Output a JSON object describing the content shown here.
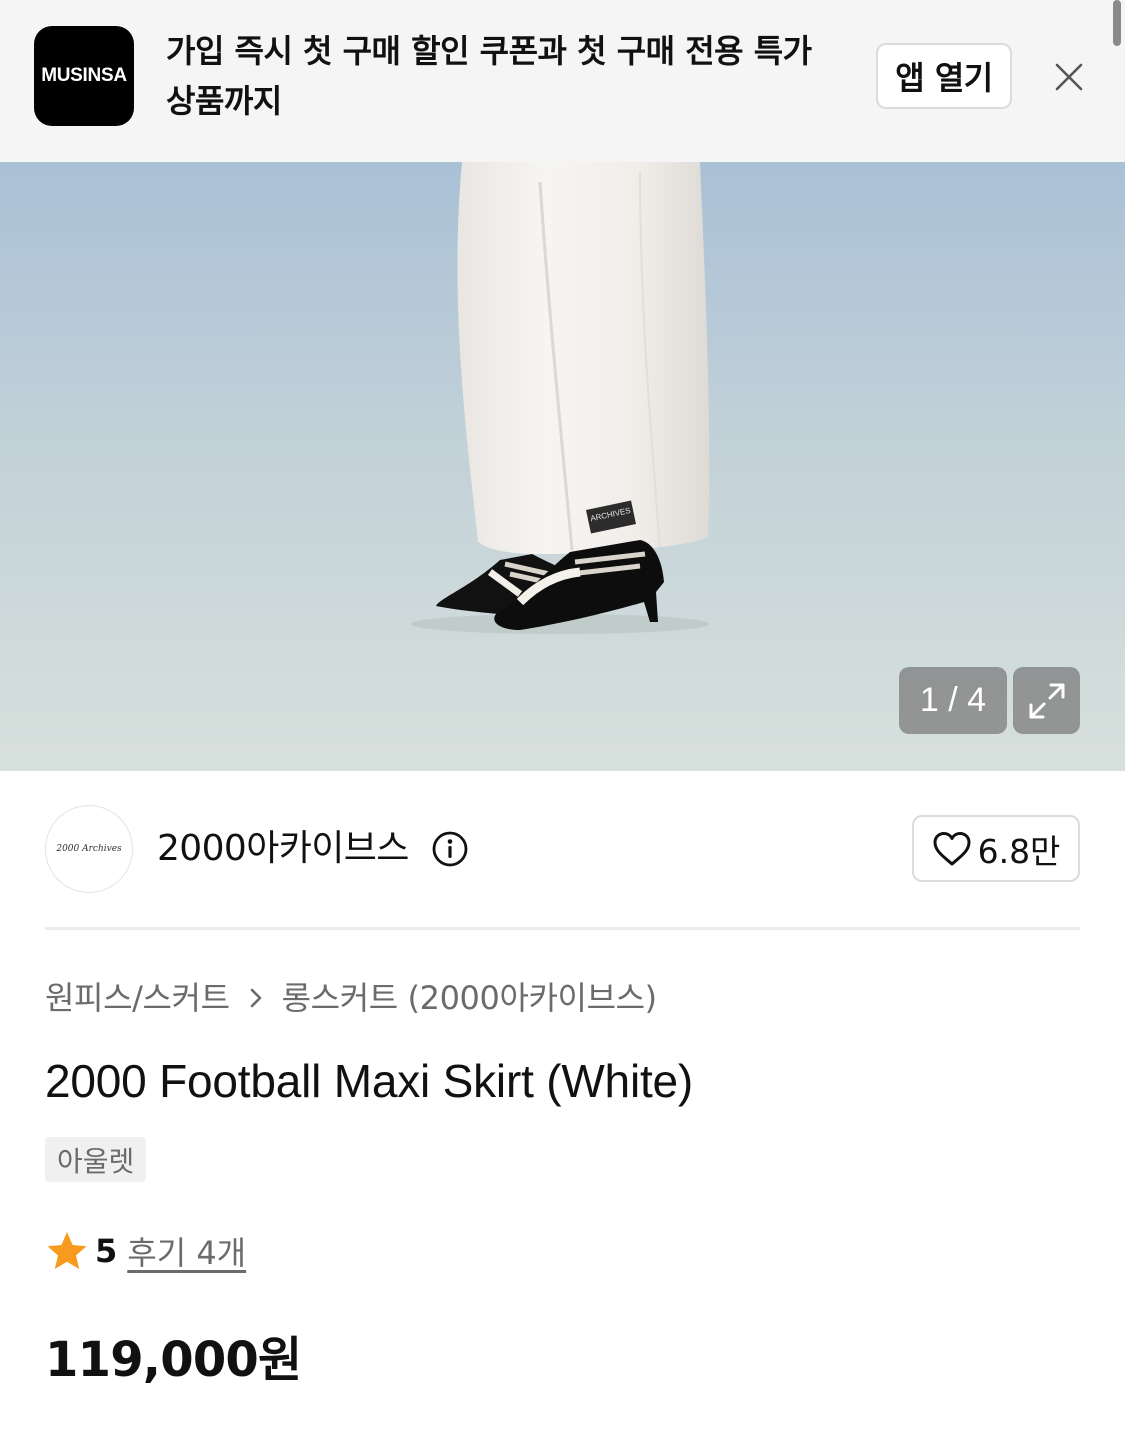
{
  "banner": {
    "logo_text": "MUSINSA",
    "message": "가입 즉시 첫 구매 할인 쿠폰과 첫 구매 전용 특가 상품까지",
    "open_app_label": "앱 열기",
    "close_icon": "close-icon"
  },
  "gallery": {
    "label_patch_text": "ARCHIVES",
    "counter": "1 / 4",
    "current": 1,
    "total": 4,
    "expand_icon": "expand-icon"
  },
  "brand": {
    "logo_text": "2000 Archives",
    "name": "2000아카이브스",
    "info_icon": "info-icon",
    "likes": "6.8만",
    "like_icon": "heart-outline-icon"
  },
  "breadcrumb": {
    "category": "원피스/스커트",
    "subcategory": "롱스커트 (2000아카이브스)"
  },
  "product": {
    "title": "2000 Football Maxi Skirt (White)",
    "badge": "아울렛",
    "rating": "5",
    "review_link": "후기 4개",
    "price": "119,000원"
  },
  "colors": {
    "banner_bg": "#f5f5f5",
    "star": "#f79a1e",
    "muted_text": "#6b6b6b"
  }
}
